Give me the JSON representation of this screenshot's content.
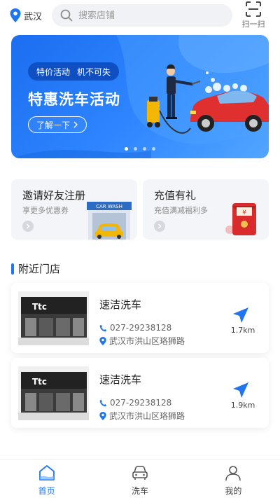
{
  "header": {
    "city": "武汉",
    "search_placeholder": "搜索店铺",
    "scan_label": "扫一扫"
  },
  "banner": {
    "tag_left": "特价活动",
    "tag_right": "机不可失",
    "title": "特惠洗车活动",
    "button_label": "了解一下",
    "slide_count": 4,
    "active_slide": 1
  },
  "promos": [
    {
      "title": "邀请好友注册",
      "subtitle": "享更多优惠券",
      "art_text": "CAR WASH"
    },
    {
      "title": "充值有礼",
      "subtitle": "充值满减福利多",
      "art_text": "¥"
    }
  ],
  "section": {
    "title": "附近门店"
  },
  "stores": [
    {
      "name": "速洁洗车",
      "phone": "027-29238128",
      "address": "武汉市洪山区珞狮路",
      "distance": "1.7km",
      "sign": "Ttc"
    },
    {
      "name": "速洁洗车",
      "phone": "027-29238128",
      "address": "武汉市洪山区珞狮路",
      "distance": "1.9km",
      "sign": "Ttc"
    }
  ],
  "tabbar": {
    "items": [
      {
        "label": "首页",
        "icon": "home-icon",
        "active": true
      },
      {
        "label": "洗车",
        "icon": "car-icon",
        "active": false
      },
      {
        "label": "我的",
        "icon": "user-icon",
        "active": false
      }
    ]
  },
  "colors": {
    "accent": "#1f76f0",
    "banner_start": "#1b6ef0",
    "banner_end": "#52a6ff"
  }
}
